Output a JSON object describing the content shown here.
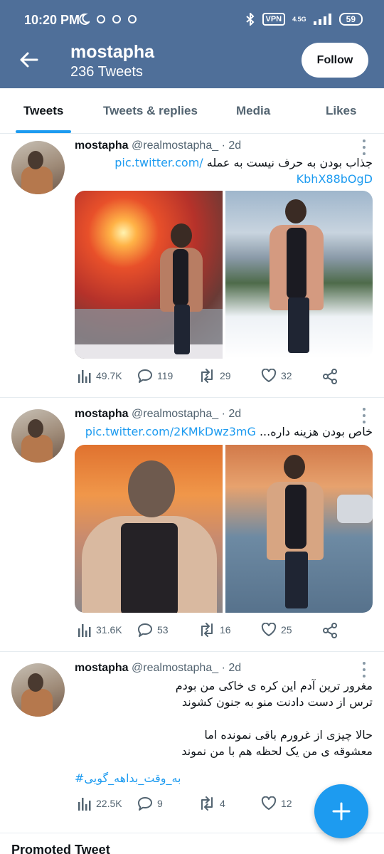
{
  "status_bar": {
    "time": "10:20 PM",
    "vpn": "VPN",
    "network": "4.5G",
    "battery": "59"
  },
  "header": {
    "title": "mostapha",
    "subtitle": "236 Tweets",
    "follow_label": "Follow"
  },
  "tabs": [
    {
      "label": "Tweets",
      "active": true
    },
    {
      "label": "Tweets & replies",
      "active": false
    },
    {
      "label": "Media",
      "active": false
    },
    {
      "label": "Likes",
      "active": false
    }
  ],
  "tweets": [
    {
      "name": "mostapha",
      "meta": "@realmostapha_ · 2d",
      "text_line1": "جذاب بودن به حرف نیست به عمله",
      "link_inline": "pic.twitter.com/",
      "link_line2": "KbhX88bOgD",
      "views": "49.7K",
      "replies": "119",
      "retweets": "29",
      "likes": "32"
    },
    {
      "name": "mostapha",
      "meta": "@realmostapha_ · 2d",
      "text_line1": "خاص بودن هزینه داره...",
      "link_inline": "pic.twitter.com/2KMkDwz3mG",
      "views": "31.6K",
      "replies": "53",
      "retweets": "16",
      "likes": "25"
    },
    {
      "name": "mostapha",
      "meta": "@realmostapha_ · 2d",
      "lines": [
        "مغرور ترین آدم این کره ی خاکی من بودم",
        "ترس از دست دادنت منو به جنون کشوند",
        "",
        "حالا چیزی از غرورم باقی نمونده اما",
        "معشوقه ی من یک لحظه هم با من نموند"
      ],
      "hashtag": "#به_وقت_بداهه_گویی",
      "views": "22.5K",
      "replies": "9",
      "retweets": "4",
      "likes": "12"
    }
  ],
  "promoted_label": "Promoted Tweet",
  "colors": {
    "header_bg": "#4f6f99",
    "accent": "#1d9bf0",
    "muted": "#536471"
  }
}
